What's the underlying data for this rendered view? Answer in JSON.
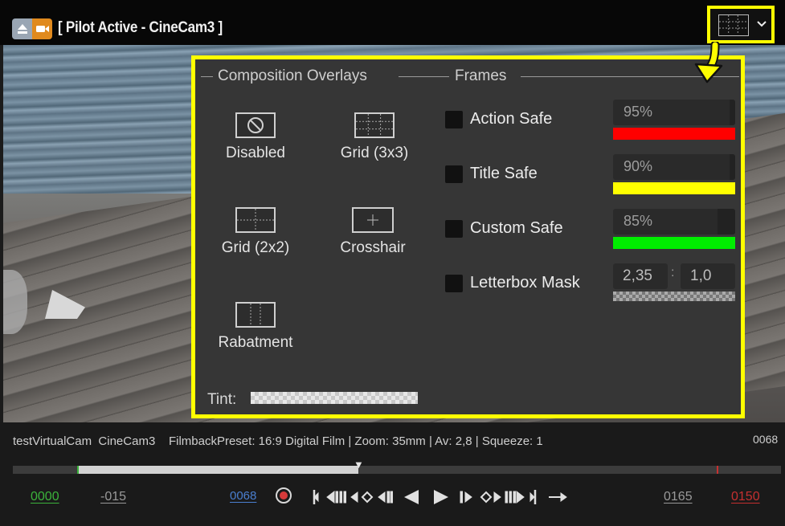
{
  "header": {
    "title": "[ Pilot Active - CineCam3 ]"
  },
  "composition": {
    "section_title": "Composition Overlays",
    "items": [
      {
        "label": "Disabled",
        "icon": "disabled-icon"
      },
      {
        "label": "Grid (3x3)",
        "icon": "grid-3x3-icon"
      },
      {
        "label": "Grid (2x2)",
        "icon": "grid-2x2-icon"
      },
      {
        "label": "Crosshair",
        "icon": "crosshair-icon"
      },
      {
        "label": "Rabatment",
        "icon": "rabatment-icon"
      }
    ],
    "tint_label": "Tint:"
  },
  "frames": {
    "section_title": "Frames",
    "rows": [
      {
        "label": "Action Safe",
        "value": "95%",
        "color": "#ff0000",
        "checked": false
      },
      {
        "label": "Title Safe",
        "value": "90%",
        "color": "#ffff00",
        "checked": false
      },
      {
        "label": "Custom Safe",
        "value": "85%",
        "color": "#00ee00",
        "checked": false
      }
    ],
    "letterbox": {
      "label": "Letterbox Mask",
      "ratio_a": "2,35",
      "separator": ":",
      "ratio_b": "1,0",
      "checked": false
    }
  },
  "timeline": {
    "info": "testVirtualCam  CineCam3    FilmbackPreset: 16:9 Digital Film | Zoom: 35mm | Av: 2,8 | Squeeze: 1",
    "current_frame_top": "0068",
    "start_frame": "0000",
    "pre_roll": "-015",
    "current_frame": "0068",
    "post_roll": "0165",
    "end_frame": "0150",
    "playhead_fraction": 0.45,
    "colors": {
      "start": "#3bb33b",
      "end": "#c63030",
      "current": "#4a7fd0"
    }
  }
}
